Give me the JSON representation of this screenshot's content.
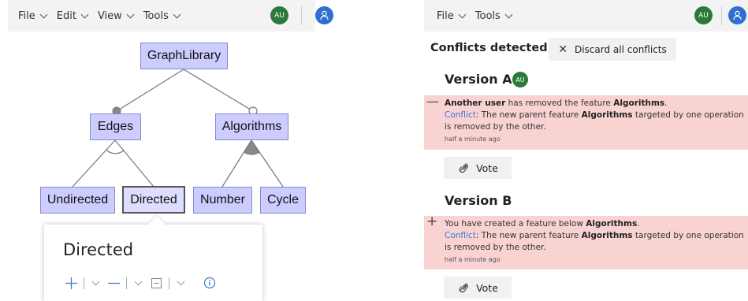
{
  "left_pane": {
    "menu": [
      {
        "label": "File"
      },
      {
        "label": "Edit"
      },
      {
        "label": "View"
      },
      {
        "label": "Tools"
      }
    ],
    "avatar_initials": "AU",
    "diagram": {
      "features": {
        "root": "GraphLibrary",
        "edges": "Edges",
        "algorithms": "Algorithms",
        "undirected": "Undirected",
        "directed": "Directed",
        "number": "Number",
        "cycle": "Cycle"
      },
      "selected_feature": "Directed"
    },
    "popover": {
      "title": "Directed"
    }
  },
  "right_pane": {
    "menu": [
      {
        "label": "File"
      },
      {
        "label": "Tools"
      }
    ],
    "avatar_initials": "AU",
    "conflicts_title": "Conflicts detected!",
    "discard_button": "Discard all conflicts",
    "version_a": {
      "heading": "Version A",
      "avatar_initials": "AU",
      "entry": {
        "actor": "Another user",
        "action": " has removed the feature ",
        "feature": "Algorithms",
        "period": ".",
        "conflict_label": "Conflict",
        "conflict_text_1": ": The new parent feature ",
        "conflict_feature": "Algorithms",
        "conflict_text_2": " targeted by one operation is removed by the other.",
        "time": "half a minute ago"
      },
      "vote_label": "Vote"
    },
    "version_b": {
      "heading": "Version B",
      "entry": {
        "action": "You have created a feature below ",
        "feature": "Algorithms",
        "period": ".",
        "conflict_label": "Conflict",
        "conflict_text_1": ": The new parent feature ",
        "conflict_feature": "Algorithms",
        "conflict_text_2": " targeted by one operation is removed by the other.",
        "time": "half a minute ago"
      },
      "vote_label": "Vote"
    }
  },
  "colors": {
    "feature_fill": "#ccccff",
    "conflict_bg": "#f9d2d2",
    "avatar_green": "#2a7a3a",
    "avatar_blue": "#2f6fcf",
    "link_blue": "#3a7bd5"
  }
}
